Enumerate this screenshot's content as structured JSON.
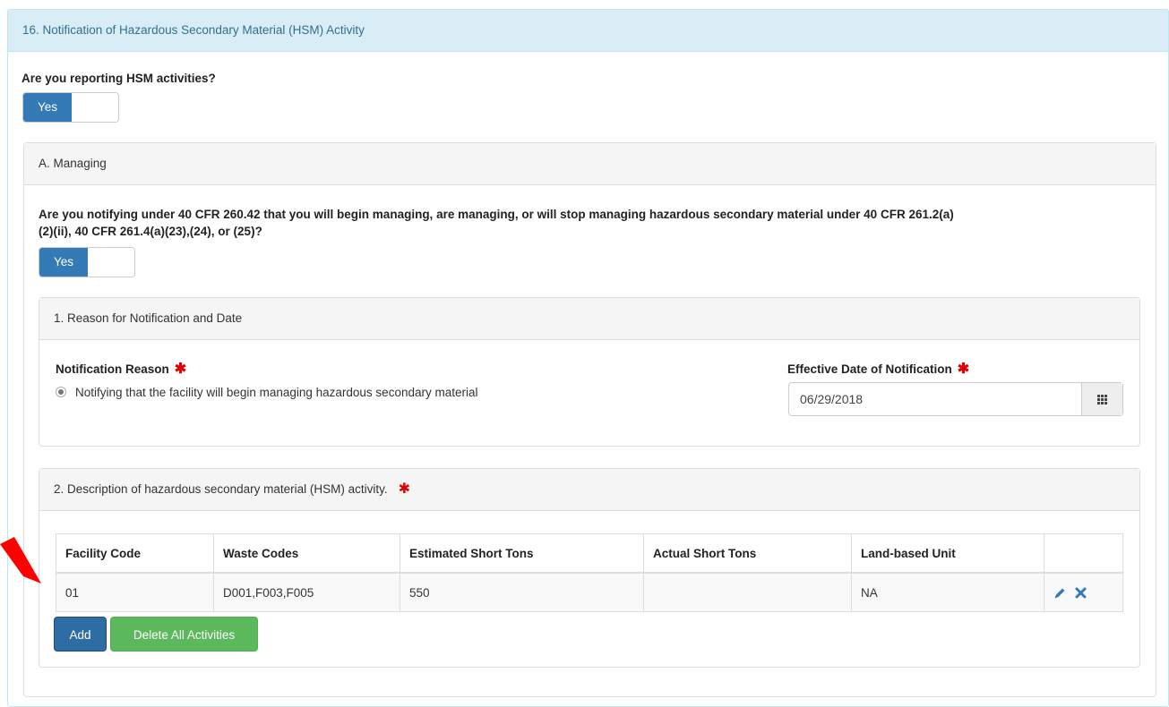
{
  "section": {
    "title": "16. Notification of Hazardous Secondary Material (HSM) Activity"
  },
  "hsm_question": {
    "label": "Are you reporting HSM activities?",
    "toggle_label": "Yes"
  },
  "managing": {
    "heading": "A. Managing",
    "question_line1": "Are you notifying under 40 CFR 260.42 that you will begin managing, are managing, or will stop managing hazardous secondary material under 40 CFR 261.2(a)",
    "question_line2": "(2)(ii), 40 CFR 261.4(a)(23),(24), or (25)?",
    "toggle_label": "Yes"
  },
  "reason_panel": {
    "heading": "1. Reason for Notification and Date",
    "reason_label": "Notification Reason",
    "reason_option": "Notifying that the facility will begin managing hazardous secondary material",
    "date_label": "Effective Date of Notification",
    "date_value": "06/29/2018",
    "required_mark": "✱"
  },
  "activity_panel": {
    "heading": "2. Description of hazardous secondary material (HSM) activity.",
    "required_mark": "✱",
    "columns": [
      "Facility Code",
      "Waste Codes",
      "Estimated Short Tons",
      "Actual Short Tons",
      "Land-based Unit"
    ],
    "rows": [
      {
        "facility_code": "01",
        "waste_codes": "D001,F003,F005",
        "estimated": "550",
        "actual": "",
        "land_unit": "NA"
      }
    ],
    "add_label": "Add",
    "delete_all_label": "Delete All Activities"
  },
  "icons": {
    "edit": "pencil-icon",
    "delete": "close-icon",
    "calendar": "calendar-icon",
    "annotation": "red-arrow-icon"
  },
  "colors": {
    "primary": "#337ab7",
    "success": "#5cb85c",
    "required": "#e00000",
    "info_bg": "#d9edf7",
    "annotation": "#ff0000"
  }
}
